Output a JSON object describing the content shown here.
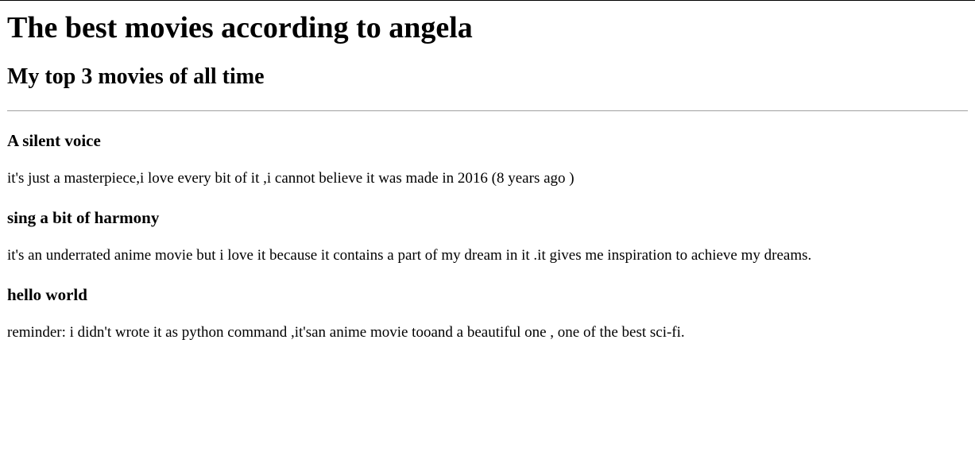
{
  "page": {
    "title": "The best movies according to angela",
    "subtitle": "My top 3 movies of all time"
  },
  "movies": [
    {
      "title": "A silent voice",
      "description": "it's just a masterpiece,i love every bit of it ,i cannot believe it was made in 2016 (8 years ago )"
    },
    {
      "title": "sing a bit of harmony",
      "description": "it's an underrated anime movie but i love it because it contains a part of my dream in it .it gives me inspiration to achieve my dreams."
    },
    {
      "title": "hello world",
      "description": "reminder: i didn't wrote it as python command ,it'san anime movie tooand a beautiful one , one of the best sci-fi."
    }
  ]
}
